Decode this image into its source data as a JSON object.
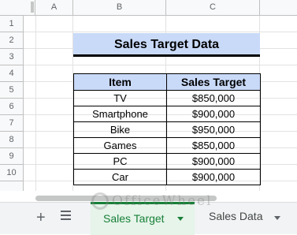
{
  "columns": [
    "A",
    "B",
    "C"
  ],
  "rows": [
    "1",
    "2",
    "3",
    "4",
    "5",
    "6",
    "7",
    "8",
    "9",
    "10"
  ],
  "title": "Sales Target Data",
  "table": {
    "headers": [
      "Item",
      "Sales Target"
    ],
    "rows": [
      [
        "TV",
        "$850,000"
      ],
      [
        "Smartphone",
        "$900,000"
      ],
      [
        "Bike",
        "$950,000"
      ],
      [
        "Games",
        "$850,000"
      ],
      [
        "PC",
        "$900,000"
      ],
      [
        "Car",
        "$900,000"
      ]
    ]
  },
  "tabs": {
    "add_icon": "plus-icon",
    "list_icon": "sheet-list-icon",
    "active": "Sales Target",
    "other": "Sales Data"
  },
  "watermark": "OfficeWheel",
  "colors": {
    "header_fill": "#c9daf8",
    "active_tab": "#188038"
  }
}
